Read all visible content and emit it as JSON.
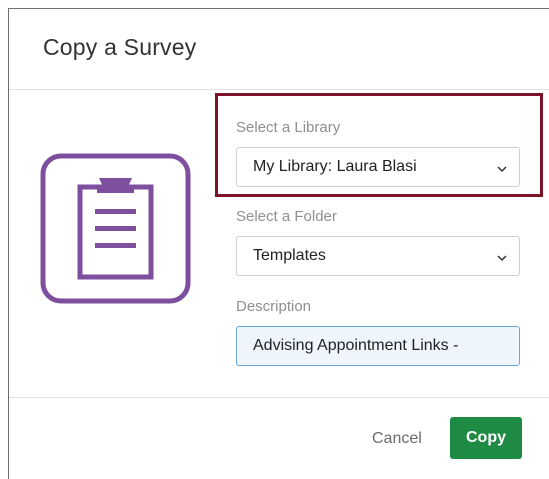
{
  "dialog": {
    "title": "Copy a Survey"
  },
  "form": {
    "library": {
      "label": "Select a Library",
      "value": "My Library: Laura Blasi"
    },
    "folder": {
      "label": "Select a Folder",
      "value": "Templates"
    },
    "description": {
      "label": "Description",
      "value": "Advising Appointment Links -"
    }
  },
  "footer": {
    "cancel_label": "Cancel",
    "copy_label": "Copy"
  },
  "colors": {
    "icon_purple": "#7f4f9f",
    "highlight_border": "#7c1328",
    "primary_green": "#1f8a43",
    "input_focus_border": "#6aa7de"
  },
  "icons": {
    "survey": "clipboard-icon",
    "dropdown": "chevron-down-icon"
  }
}
